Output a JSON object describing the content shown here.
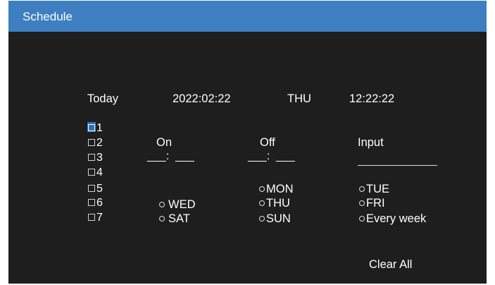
{
  "title": "Schedule",
  "status": {
    "today_label": "Today",
    "date": "2022:02:22",
    "day": "THU",
    "time": "12:22:22"
  },
  "headers": {
    "on": "On",
    "off": "Off",
    "input": "Input"
  },
  "slots": [
    "1",
    "2",
    "3",
    "4",
    "5",
    "6",
    "7"
  ],
  "selected_slot": "1",
  "time_fields": {
    "on": "___:  ___",
    "off": "___:  ___"
  },
  "days": {
    "mon": "MON",
    "tue": "TUE",
    "wed": "WED",
    "thu": "THU",
    "fri": "FRI",
    "sat": "SAT",
    "sun": "SUN",
    "every_week": "Every week"
  },
  "actions": {
    "clear_all": "Clear All"
  },
  "colors": {
    "title_bar": "#3d7fc1",
    "background": "#1e1e1e",
    "text": "#ffffff",
    "highlight": "#2f6fb3"
  }
}
